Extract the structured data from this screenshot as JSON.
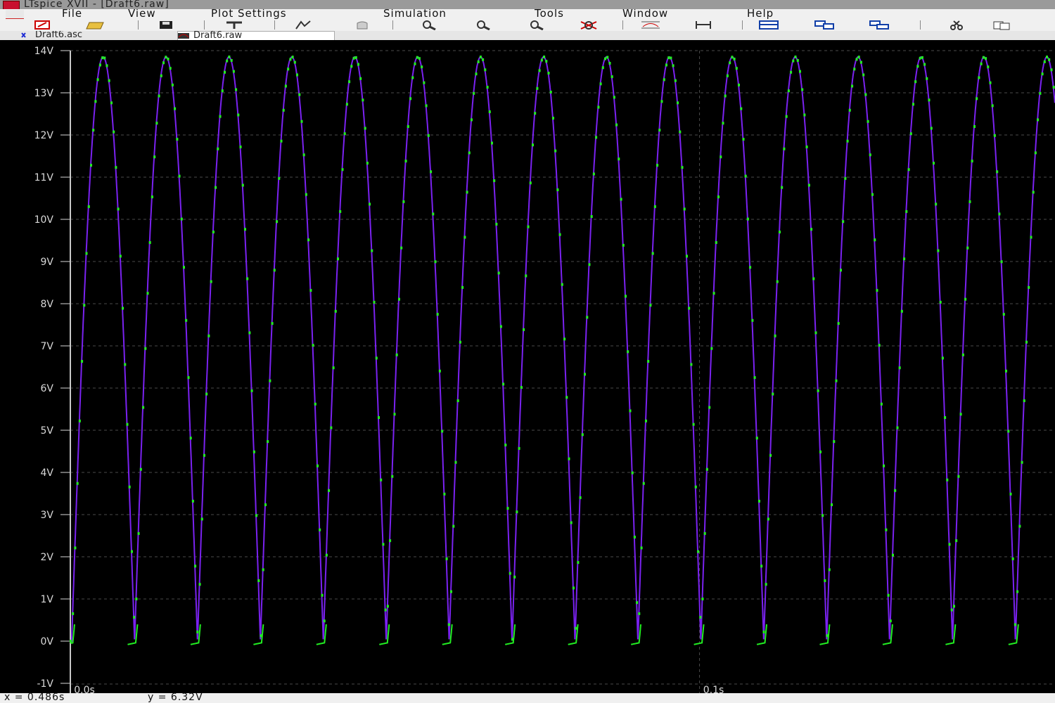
{
  "window": {
    "title": "LTspice XVII - [Draft6.raw]"
  },
  "menu": [
    "File",
    "View",
    "Plot Settings",
    "Simulation",
    "Tools",
    "Window",
    "Help"
  ],
  "toolbar": {
    "icons": [
      "new-schematic-icon",
      "open-icon",
      "save-icon",
      "control-panel-icon",
      "run-icon",
      "halt-icon",
      "zoom-in-icon",
      "zoom-extents-icon",
      "zoom-out-icon",
      "zoom-cancel-icon",
      "autorange-icon",
      "mark-text-icon",
      "tile-horizontal-icon",
      "tile-vertical-icon",
      "cascade-icon",
      "cut-icon",
      "copy-icon"
    ]
  },
  "tabs": [
    {
      "label": "Draft6.asc",
      "icon": "schematic-icon",
      "active": false
    },
    {
      "label": "Draft6.raw",
      "icon": "waveform-icon",
      "active": true
    }
  ],
  "status": {
    "x_readout": "x = 0.486s",
    "y_readout": "y = 6.32V"
  },
  "colors": {
    "background": "#000000",
    "trace_primary": "#7a22f0",
    "trace_secondary": "#22ee22",
    "grid": "#4a4a4a",
    "axis_text": "#d8d8d8"
  },
  "chart_data": {
    "type": "line",
    "title": "",
    "xlabel": "",
    "ylabel": "",
    "x_tick_labels": [
      "0.0s",
      "0.1s"
    ],
    "y_tick_labels": [
      "-1V",
      "0V",
      "1V",
      "2V",
      "3V",
      "4V",
      "5V",
      "6V",
      "7V",
      "8V",
      "9V",
      "10V",
      "11V",
      "12V",
      "13V",
      "14V"
    ],
    "ylim": [
      -1,
      14
    ],
    "xlim": [
      0.0,
      0.1565
    ],
    "grid": true,
    "legend": "none",
    "series": [
      {
        "color": "#7a22f0",
        "x": [
          0.0,
          0.00021,
          0.0005,
          0.001,
          0.002,
          0.003,
          0.004,
          0.005,
          0.006,
          0.007,
          0.008,
          0.009,
          0.01,
          0.011,
          0.012,
          0.013,
          0.014,
          0.015,
          0.016,
          0.017,
          0.018,
          0.019,
          0.02
        ],
        "values": [
          0.0,
          0.5,
          1.6,
          4.3,
          8.8,
          12.0,
          13.8,
          13.2,
          10.5,
          6.3,
          1.6,
          -0.06,
          -0.06,
          1.6,
          6.3,
          10.5,
          13.2,
          13.8,
          12.0,
          8.8,
          4.3,
          -0.06,
          0.5
        ],
        "period": 0.02,
        "cycles_from_x": 0.00021,
        "peak": 13.85
      },
      {
        "color": "#22ee22",
        "x": [
          0.0158,
          0.0165,
          0.0175,
          0.0185,
          0.0195,
          0.02,
          0.0207,
          0.0209
        ],
        "values": [
          0.5,
          -0.08,
          -0.08,
          -0.07,
          -0.06,
          0.0,
          0.2,
          0.45
        ],
        "period": 0.02
      }
    ]
  }
}
